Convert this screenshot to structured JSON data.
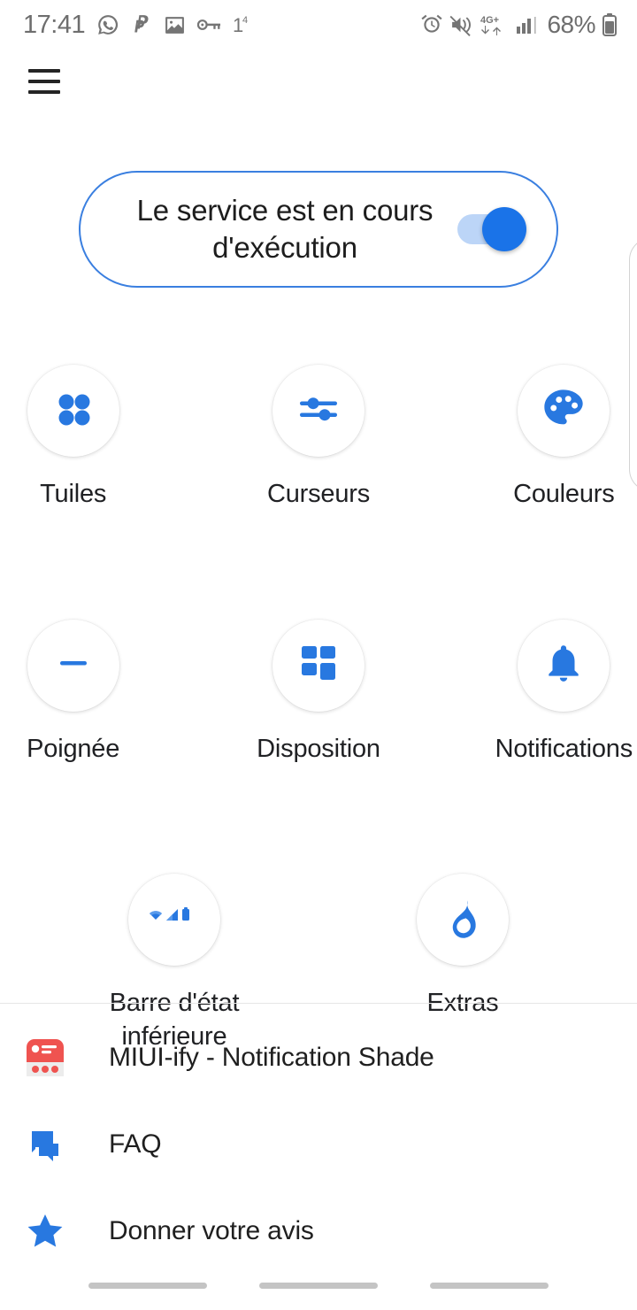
{
  "status_bar": {
    "clock": "17:41",
    "battery_percent": "68%",
    "left_icons": [
      {
        "name": "whatsapp-icon"
      },
      {
        "name": "paypal-icon"
      },
      {
        "name": "photos-icon"
      },
      {
        "name": "key-icon"
      },
      {
        "name": "notification-count-icon",
        "badge": "4",
        "value": "1"
      }
    ],
    "right_icons": [
      {
        "name": "alarm-icon"
      },
      {
        "name": "mute-icon"
      },
      {
        "name": "network-4gplus-icon",
        "label": "4G+"
      },
      {
        "name": "signal-bars-icon"
      },
      {
        "name": "battery-icon"
      }
    ]
  },
  "app_bar": {
    "menu_label": "Menu"
  },
  "service_card": {
    "text": "Le service est en cours d'exécution",
    "toggle_on": true,
    "accent_color": "#1a73e8",
    "border_color": "#3a7fe0",
    "track_color": "#bcd5f7"
  },
  "grid": {
    "rows": [
      [
        {
          "label": "Tuiles",
          "icon": "tiles-icon"
        },
        {
          "label": "Curseurs",
          "icon": "sliders-icon"
        },
        {
          "label": "Couleurs",
          "icon": "palette-icon"
        }
      ],
      [
        {
          "label": "Poignée",
          "icon": "handle-icon"
        },
        {
          "label": "Disposition",
          "icon": "layout-icon"
        },
        {
          "label": "Notifications",
          "icon": "bell-icon"
        }
      ],
      [
        {
          "label": "Barre d'état inférieure",
          "icon": "status-bar-icon"
        },
        {
          "label": "Extras",
          "icon": "flame-icon"
        }
      ]
    ]
  },
  "menu_list": {
    "items": [
      {
        "label": "MIUI-ify - Notification Shade",
        "icon": "miui-ify-app-icon"
      },
      {
        "label": "FAQ",
        "icon": "chat-bubbles-icon"
      },
      {
        "label": "Donner votre avis",
        "icon": "star-icon"
      }
    ]
  },
  "nav_bar": {
    "bars": [
      "recents-bar",
      "home-bar",
      "back-bar"
    ]
  },
  "colors": {
    "accent_blue": "#1a73e8",
    "icon_blue": "#2878e0",
    "app_red": "#ef5350",
    "text_dark": "#1f1f1f",
    "status_gray": "#6e6e6e"
  }
}
